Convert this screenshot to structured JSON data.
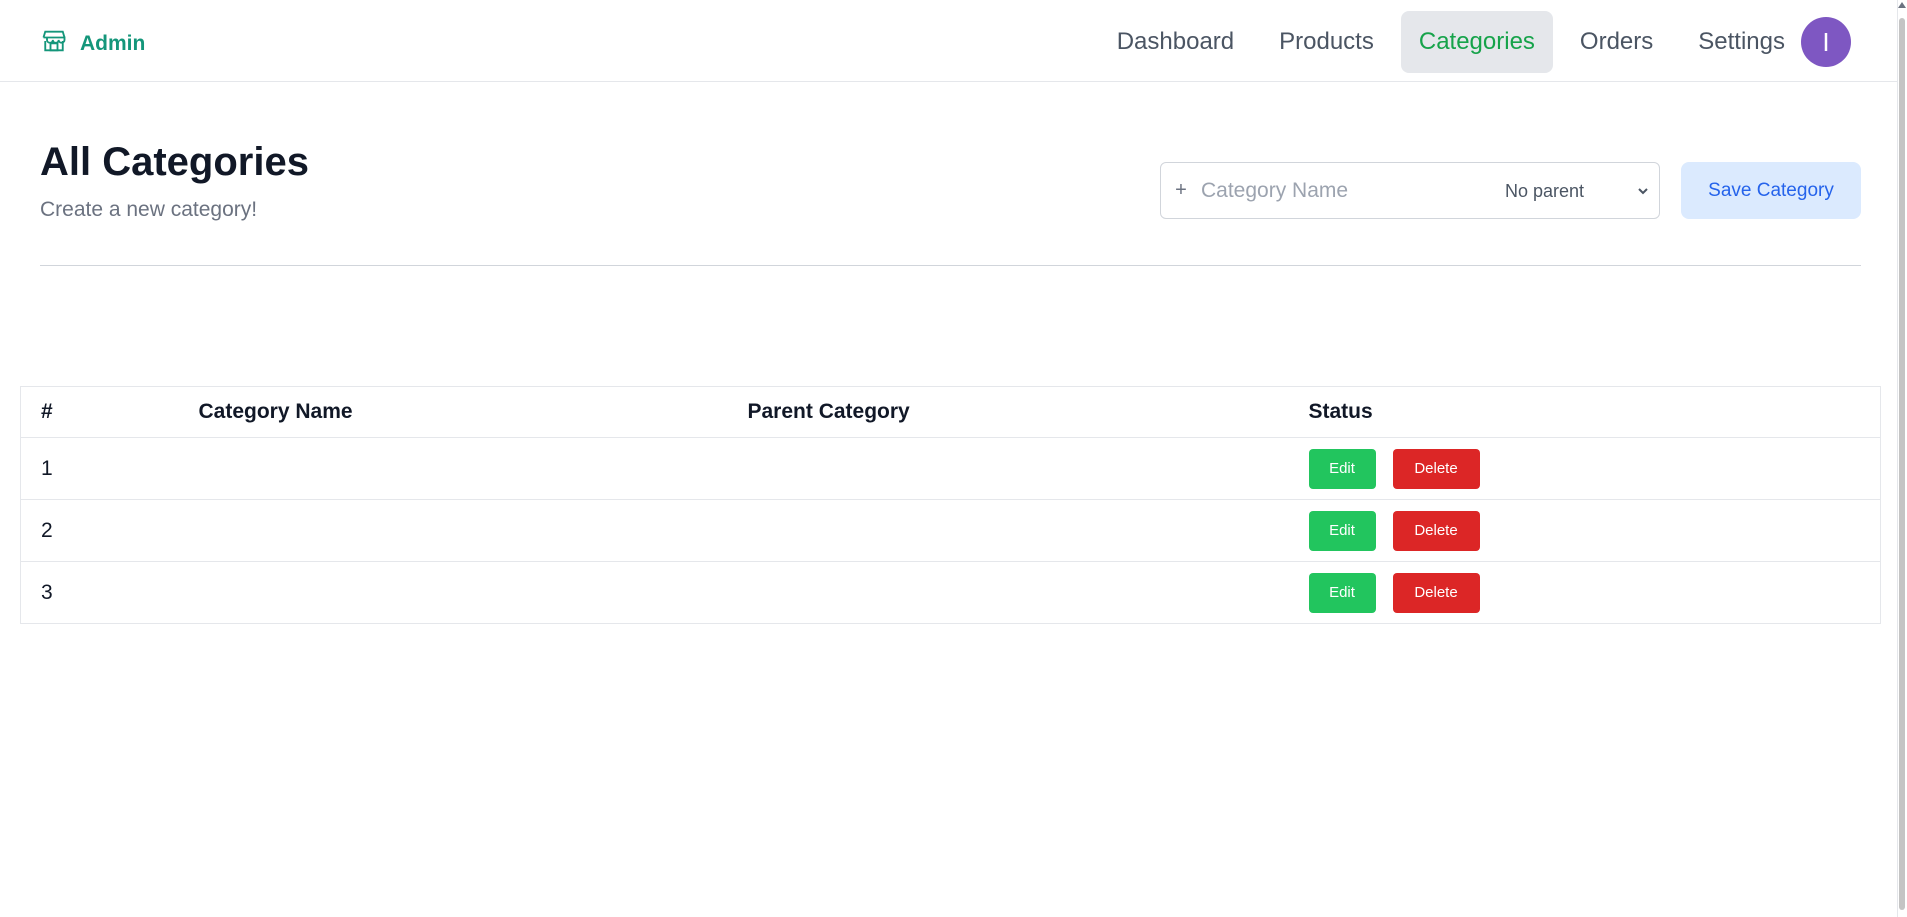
{
  "brand": {
    "name": "Admin",
    "icon": "store-icon",
    "color": "#14967a"
  },
  "nav": {
    "items": [
      {
        "label": "Dashboard"
      },
      {
        "label": "Products"
      },
      {
        "label": "Categories"
      },
      {
        "label": "Orders"
      },
      {
        "label": "Settings"
      }
    ],
    "active": "Categories",
    "active_color": "#16a34a"
  },
  "user": {
    "avatar_initial": "I",
    "avatar_color": "#7e57c2"
  },
  "header": {
    "title": "All Categories",
    "subtitle": "Create a new category!"
  },
  "form": {
    "prefix_icon": "plus-icon",
    "name_placeholder": "Category Name",
    "parent_selected": "No parent",
    "save_label": "Save Category"
  },
  "table": {
    "columns": [
      "#",
      "Category Name",
      "Parent Category",
      "Status"
    ],
    "rows": [
      {
        "num": "1",
        "name": "",
        "parent": ""
      },
      {
        "num": "2",
        "name": "",
        "parent": ""
      },
      {
        "num": "3",
        "name": "",
        "parent": ""
      }
    ],
    "edit_label": "Edit",
    "delete_label": "Delete",
    "edit_color": "#22c55e",
    "delete_color": "#dc2626"
  }
}
